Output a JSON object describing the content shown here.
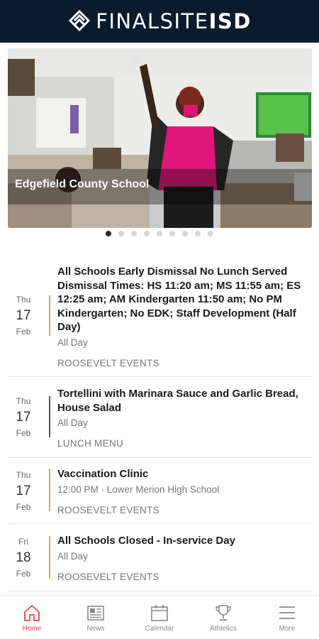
{
  "header": {
    "brand_light": "FINALSITE",
    "brand_bold": "ISD",
    "logo_icon": "finalsite-logo"
  },
  "hero": {
    "caption": "Edgefield County School",
    "slide_count": 9,
    "active_slide": 1
  },
  "events": [
    {
      "dow": "Thu",
      "day": "17",
      "month": "Feb",
      "title": "All Schools Early Dismissal No Lunch Served Dismissal Times: HS 11:20 am; MS 11:55 am; ES 12:25 am; AM Kindergarten 11:50 am; No PM Kindergarten; No EDK; Staff Development (Half Day)",
      "time": "All Day",
      "category": "ROOSEVELT EVENTS",
      "bar_color": "#c9b037"
    },
    {
      "dow": "Thu",
      "day": "17",
      "month": "Feb",
      "title": "Tortellini with Marinara Sauce and Garlic Bread, House Salad",
      "time": "All Day",
      "category": "LUNCH MENU",
      "bar_color": "#555555"
    },
    {
      "dow": "Thu",
      "day": "17",
      "month": "Feb",
      "title": "Vaccination Clinic",
      "time": "12:00 PM · Lower Merion High School",
      "category": "ROOSEVELT EVENTS",
      "bar_color": "#c9b037"
    },
    {
      "dow": "Fri",
      "day": "18",
      "month": "Feb",
      "title": "All Schools Closed - In-service Day",
      "time": "All Day",
      "category": "ROOSEVELT EVENTS",
      "bar_color": "#c9b037"
    }
  ],
  "tabbar": {
    "home": "Home",
    "news": "News",
    "calendar": "Calendar",
    "athletics": "Athletics",
    "more": "More"
  },
  "colors": {
    "header_bg": "#0b1a2c",
    "accent": "#e8474f",
    "event_bar": "#c9b037"
  }
}
